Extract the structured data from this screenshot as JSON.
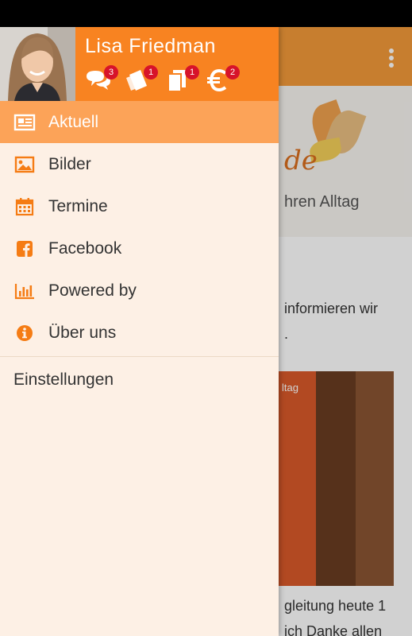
{
  "drawer": {
    "user_name": "Lisa Friedman",
    "badges": {
      "messages": "3",
      "tickets": "1",
      "documents": "1",
      "payments": "2"
    },
    "menu": [
      {
        "label": "Aktuell",
        "icon": "newspaper-icon",
        "active": true
      },
      {
        "label": "Bilder",
        "icon": "image-icon"
      },
      {
        "label": "Termine",
        "icon": "calendar-icon"
      },
      {
        "label": "Facebook",
        "icon": "facebook-icon"
      },
      {
        "label": "Powered by",
        "icon": "bar-chart-icon"
      },
      {
        "label": "Über uns",
        "icon": "info-icon"
      }
    ],
    "settings_label": "Einstellungen"
  },
  "background": {
    "logo_text": "de",
    "tagline": "hren Alltag",
    "text_line_1": "informieren wir",
    "text_line_2": ".",
    "image_label": "ltag",
    "text_line_3": "gleitung heute 1",
    "text_line_4": "ich Danke allen"
  },
  "colors": {
    "header_orange": "#f88321",
    "active_item": "#fca358",
    "drawer_bg": "#fdf0e5",
    "icon_orange": "#f57c14",
    "badge_red": "#d7132a"
  }
}
